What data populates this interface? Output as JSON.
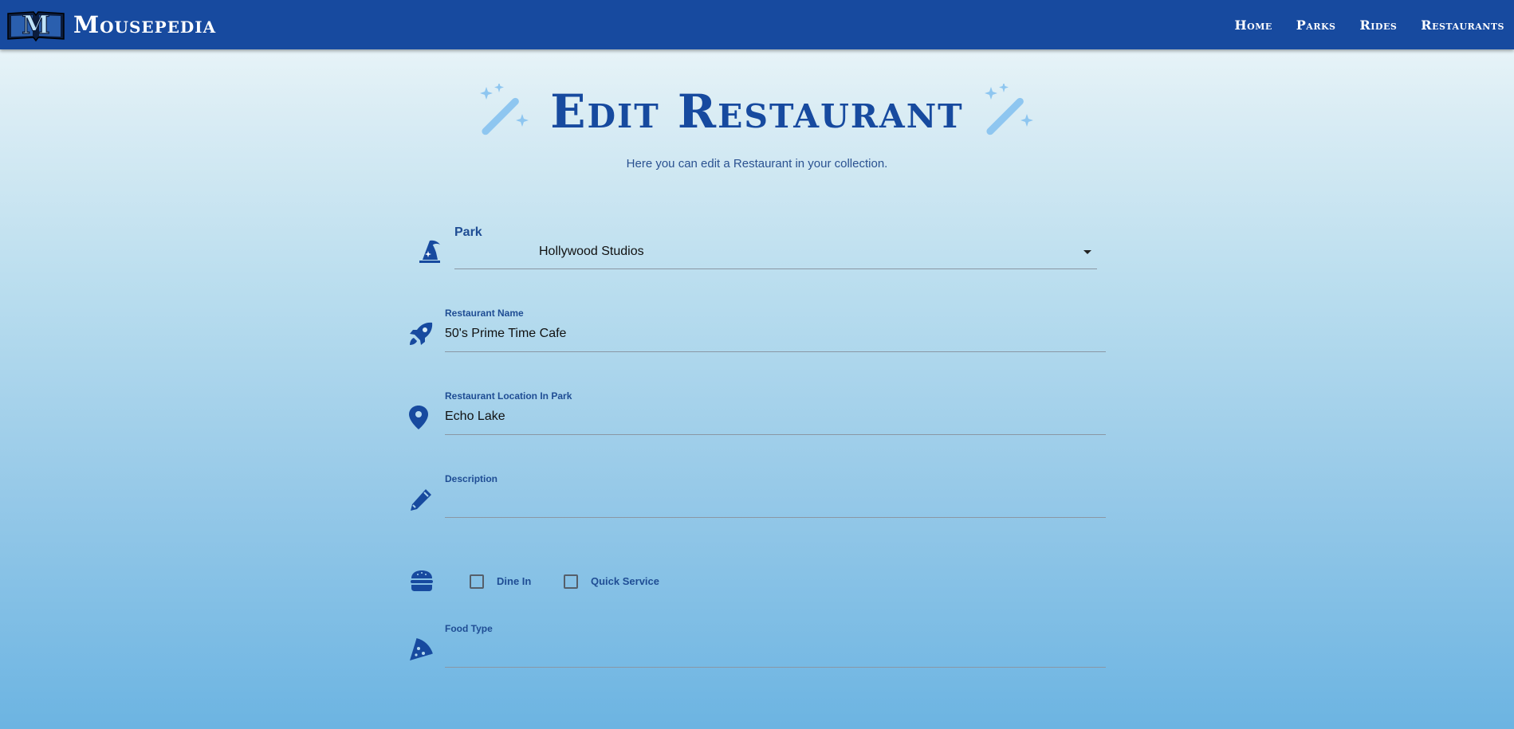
{
  "app": {
    "logo_letter": "M",
    "name": "Mousepedia"
  },
  "nav": {
    "links": [
      "Home",
      "Parks",
      "Rides",
      "Restaurants"
    ]
  },
  "page": {
    "title": "Edit Restaurant",
    "subtitle": "Here you can edit a Restaurant in your collection."
  },
  "form": {
    "park": {
      "label": "Park",
      "value": "Hollywood Studios",
      "icon": "wizard-hat-icon"
    },
    "restaurant_name": {
      "label": "Restaurant Name",
      "value": "50's Prime Time Cafe",
      "icon": "rocket-icon"
    },
    "location": {
      "label": "Restaurant Location In Park",
      "value": "Echo Lake",
      "icon": "map-pin-icon"
    },
    "description": {
      "label": "Description",
      "value": "",
      "icon": "pencil-icon"
    },
    "service": {
      "icon": "burger-icon",
      "options": [
        {
          "label": "Dine In",
          "checked": false
        },
        {
          "label": "Quick Service",
          "checked": false
        }
      ]
    },
    "food_type": {
      "label": "Food Type",
      "value": "",
      "icon": "pizza-icon"
    }
  },
  "colors": {
    "navbar": "#174a9f",
    "accent": "#174a9f",
    "wand": "#8ec6f0"
  }
}
